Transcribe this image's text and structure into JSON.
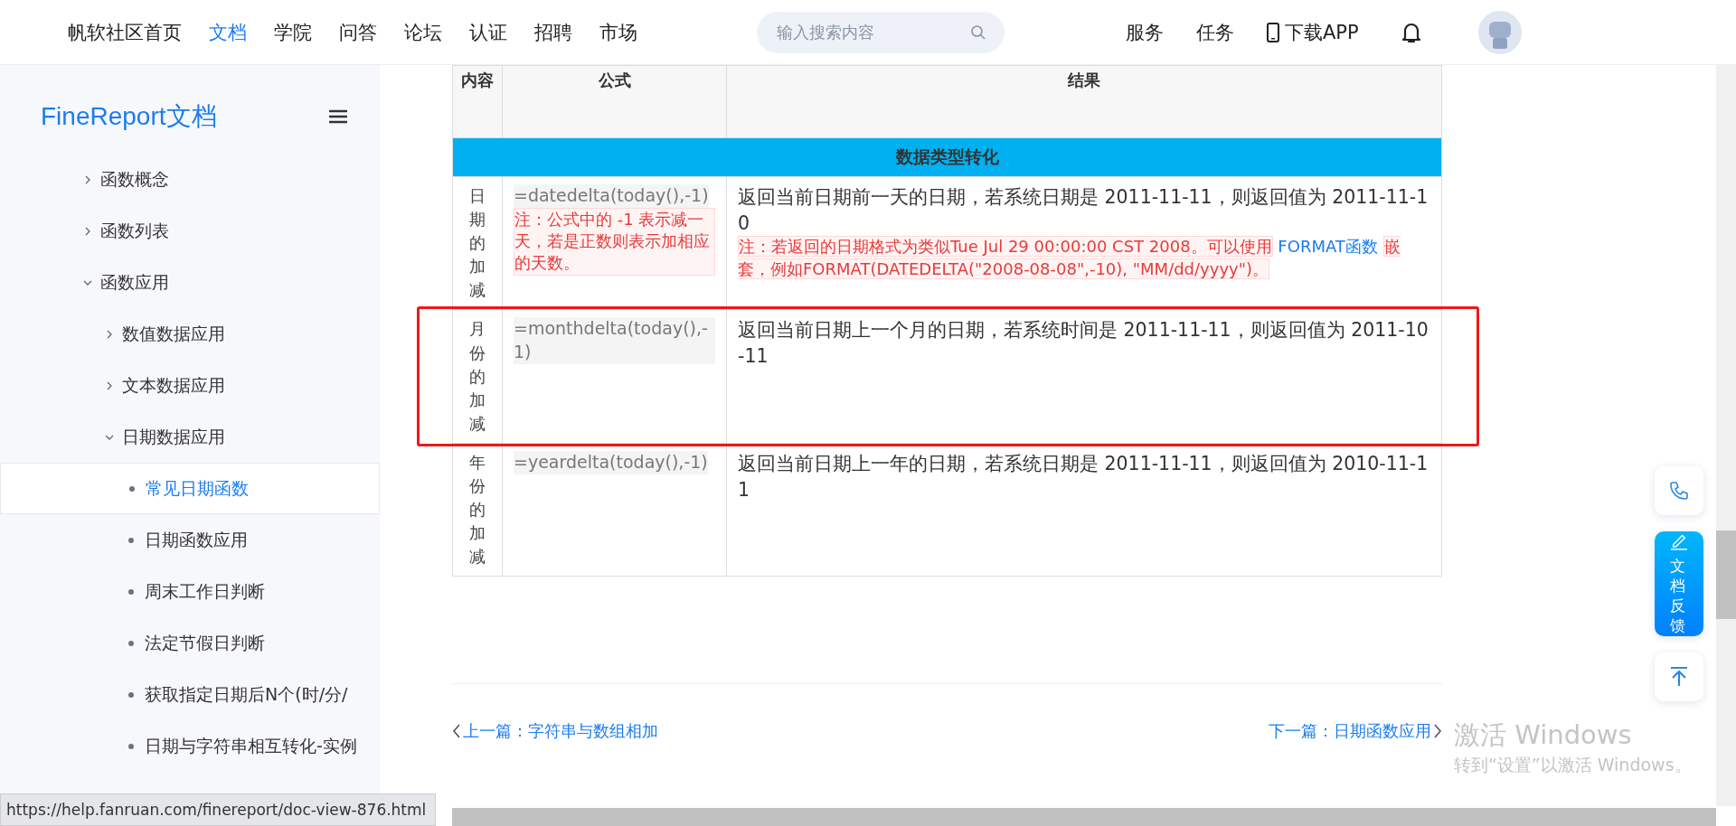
{
  "nav": {
    "home": "帆软社区首页",
    "items": [
      {
        "label": "文档",
        "selected": true
      },
      {
        "label": "学院",
        "selected": false
      },
      {
        "label": "问答",
        "selected": false
      },
      {
        "label": "论坛",
        "selected": false
      },
      {
        "label": "认证",
        "selected": false
      },
      {
        "label": "招聘",
        "selected": false
      },
      {
        "label": "市场",
        "selected": false
      }
    ],
    "search": {
      "placeholder": "输入搜索内容"
    },
    "right": [
      "服务",
      "任务"
    ],
    "download": "下载APP"
  },
  "sidebar": {
    "title": "FineReport文档",
    "items": [
      {
        "label": "函数概念",
        "expanded": false
      },
      {
        "label": "函数列表",
        "expanded": false
      },
      {
        "label": "函数应用",
        "expanded": true,
        "children": [
          {
            "label": "数值数据应用",
            "expanded": false
          },
          {
            "label": "文本数据应用",
            "expanded": false
          },
          {
            "label": "日期数据应用",
            "expanded": true,
            "children": [
              {
                "label": "常见日期函数",
                "selected": true
              },
              {
                "label": "日期函数应用",
                "selected": false
              },
              {
                "label": "周末工作日判断",
                "selected": false
              },
              {
                "label": "法定节假日判断",
                "selected": false
              },
              {
                "label": "获取指定日期后N个(时/分/",
                "selected": false
              },
              {
                "label": "日期与字符串相互转化-实例",
                "selected": false
              }
            ]
          }
        ]
      }
    ]
  },
  "table": {
    "columns": [
      "内容",
      "公式",
      "结果"
    ],
    "section": "数据类型转化",
    "rows": [
      {
        "name": "日期的加减",
        "formula": "=datedelta(today(),-1)",
        "formula_note": "注：公式中的 -1 表示减一天，若是正数则表示加相应的天数。",
        "result": "返回当前日期前一天的日期，若系统日期是 2011-11-11，则返回值为 2011-11-10",
        "result_note_before": "注：若返回的日期格式为类似Tue Jul 29 00:00:00 CST 2008。可以使用",
        "result_note_link": "FORMAT函数",
        "result_note_after": "嵌套，例如FORMAT(DATEDELTA(\"2008-08-08\",-10), \"MM/dd/yyyy\")。",
        "highlighted": false
      },
      {
        "name": "月份的加减",
        "formula": "=monthdelta(today(),-1)",
        "result": "返回当前日期上一个月的日期，若系统时间是 2011-11-11，则返回值为 2011-10-11",
        "highlighted": true
      },
      {
        "name": "年份的加减",
        "formula": "=yeardelta(today(),-1)",
        "result": "返回当前日期上一年的日期，若系统日期是 2011-11-11，则返回值为 2010-11-11",
        "highlighted": false
      }
    ]
  },
  "pager": {
    "prev": "上一篇：字符串与数组相加",
    "next": "下一篇：日期函数应用"
  },
  "float_buttons": {
    "feedback": "文档反馈"
  },
  "watermark": {
    "title": "激活 Windows",
    "subtitle": "转到“设置”以激活 Windows。"
  },
  "status_url": "https://help.fanruan.com/finereport/doc-view-876.html"
}
